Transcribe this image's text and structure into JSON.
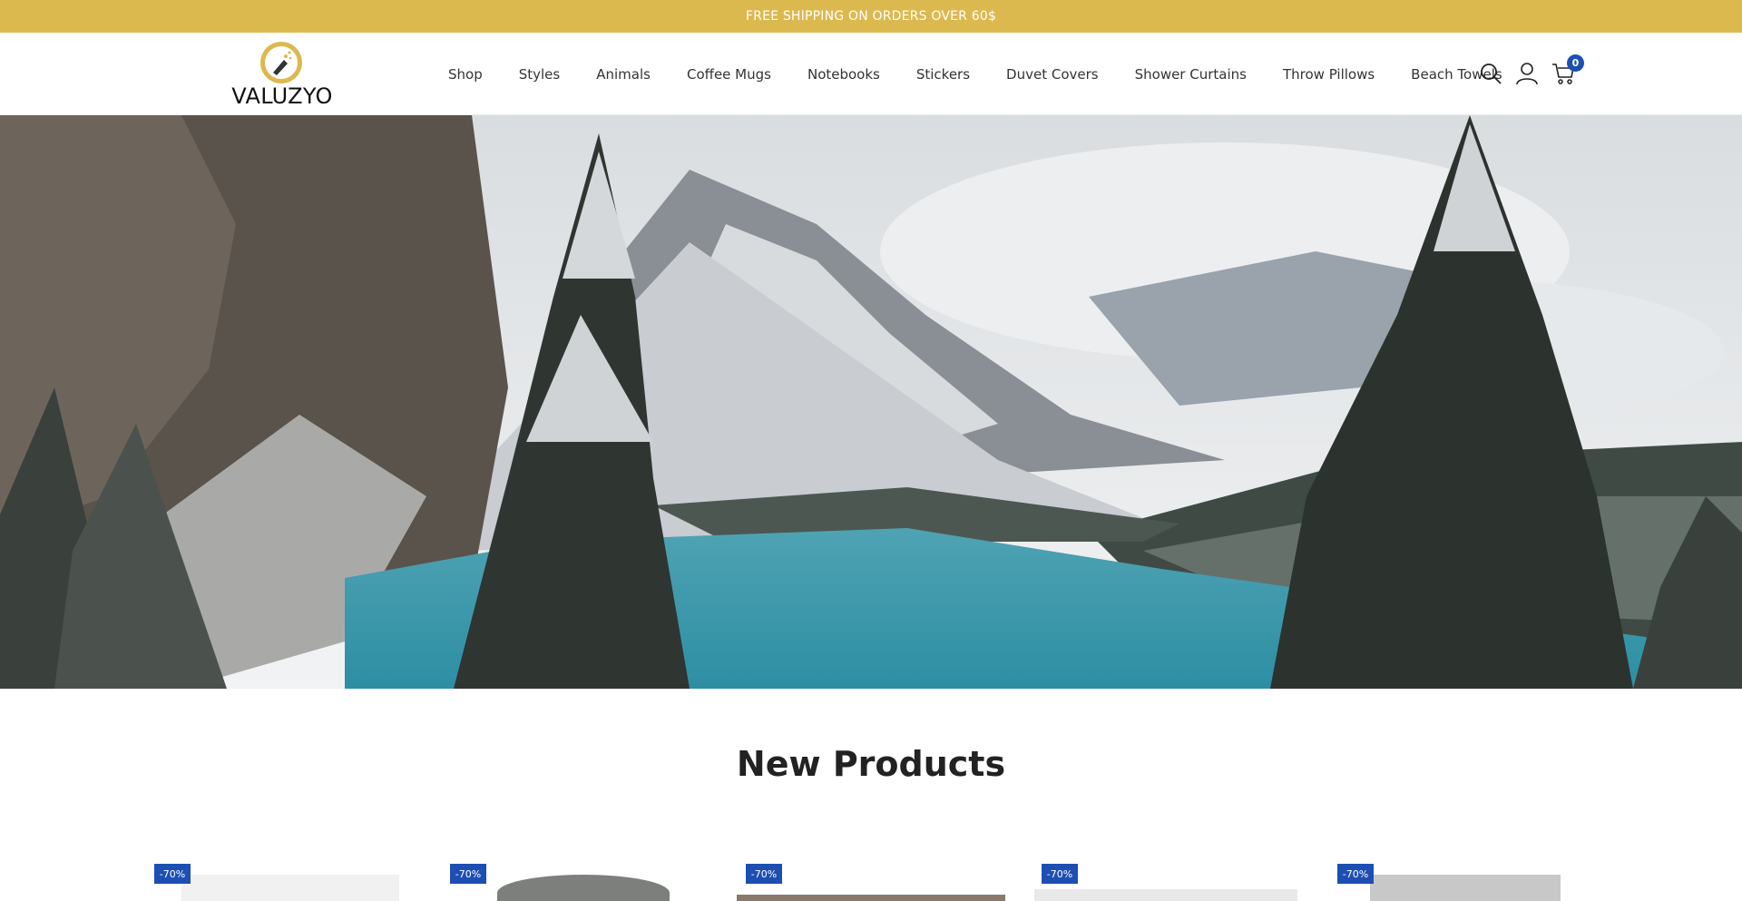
{
  "announcement": "FREE SHIPPING ON ORDERS OVER 60$",
  "brand": {
    "name": "VALUZYO"
  },
  "nav": [
    "Shop",
    "Styles",
    "Animals",
    "Coffee Mugs",
    "Notebooks",
    "Stickers",
    "Duvet Covers",
    "Shower Curtains",
    "Throw Pillows",
    "Beach Towels"
  ],
  "header_icons": [
    "search-icon",
    "user-icon",
    "cart-icon"
  ],
  "cart": {
    "count": "0"
  },
  "hero": {
    "image": "snowy mountain lake landscape"
  },
  "section": {
    "title": "New Products"
  },
  "products": [
    {
      "badge": "-70%"
    },
    {
      "badge": "-70%"
    },
    {
      "badge": "-70%"
    },
    {
      "badge": "-70%"
    },
    {
      "badge": "-70%"
    }
  ],
  "colors": {
    "announcement_bar": "#dcb94f",
    "badge": "#1d4fb3",
    "text": "#222222"
  }
}
